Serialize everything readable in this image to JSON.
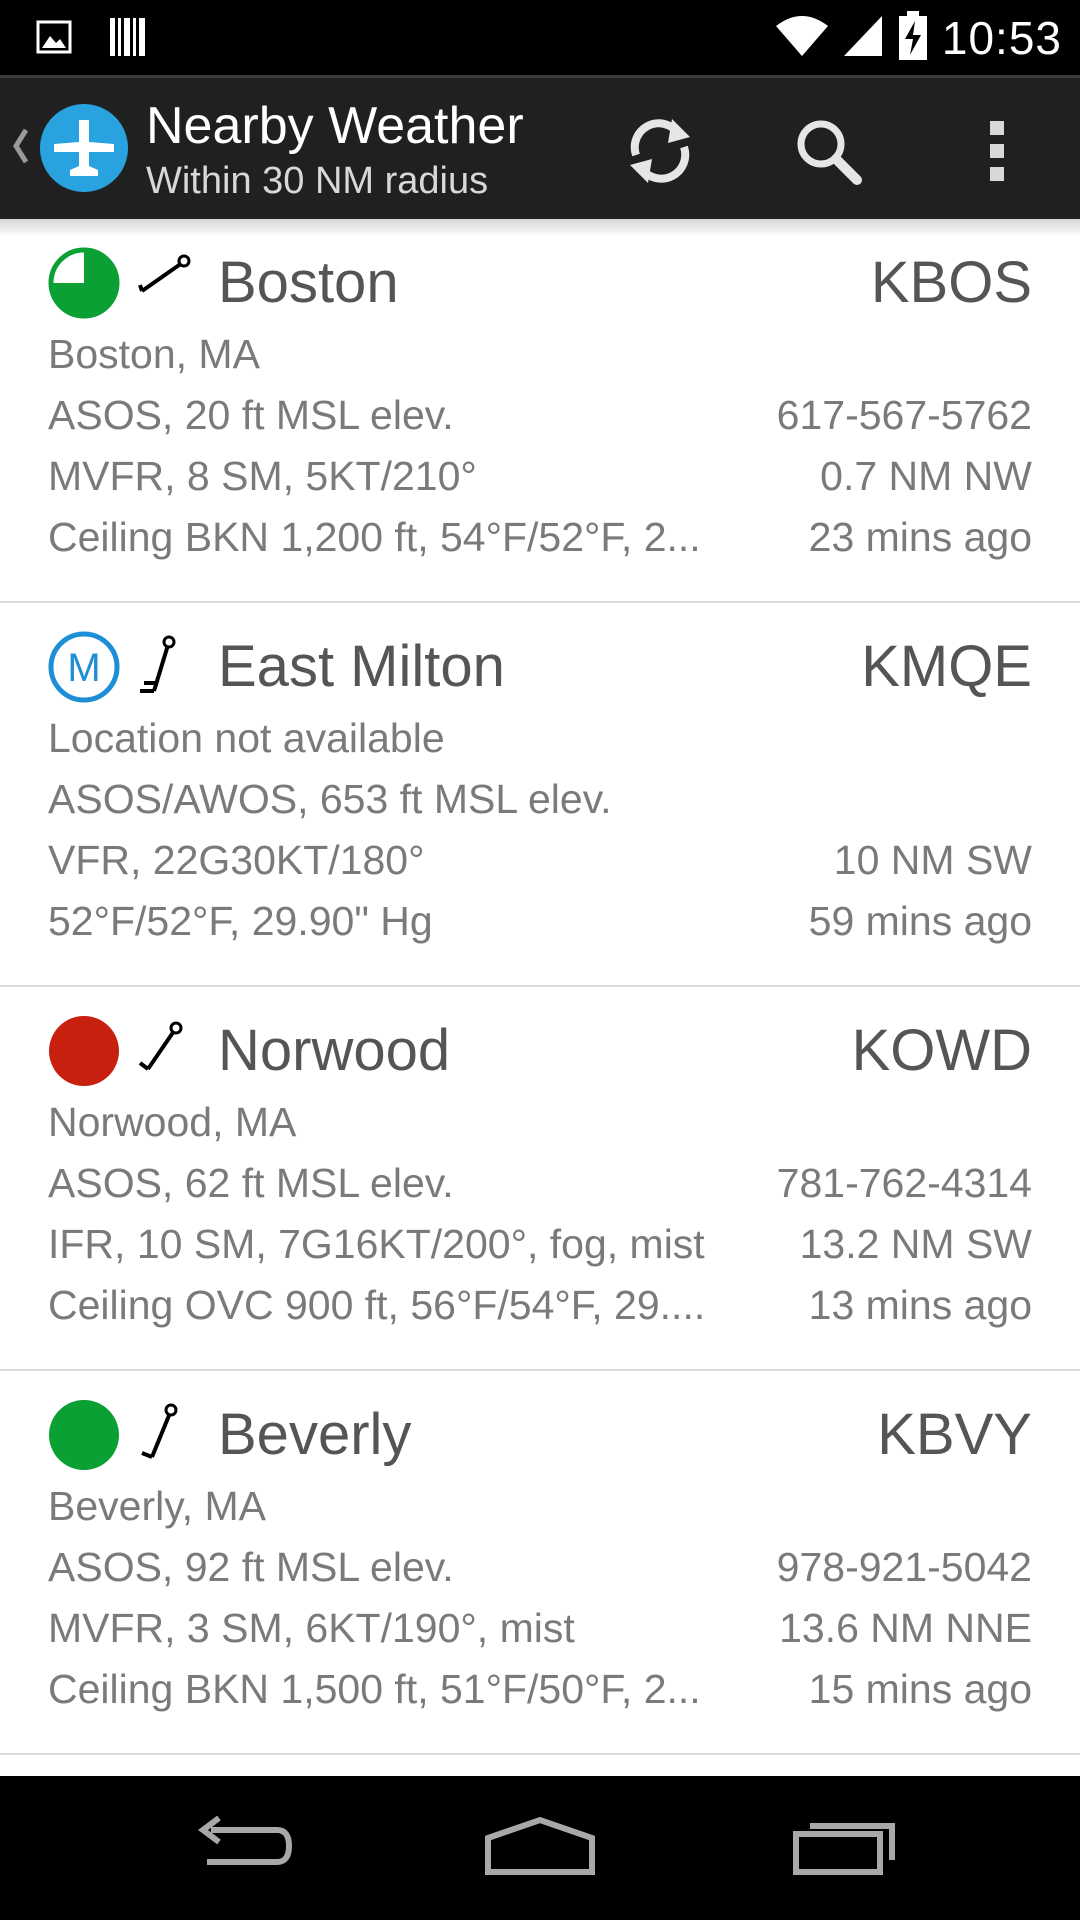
{
  "status_bar": {
    "time": "10:53",
    "left_icons": [
      "gallery-icon",
      "barcode-icon"
    ],
    "right_icons": [
      "wifi-icon",
      "signal-icon",
      "battery-charging-icon"
    ]
  },
  "action_bar": {
    "title": "Nearby Weather",
    "subtitle": "Within 30 NM radius",
    "icons": [
      "up-caret-icon",
      "airplane-logo-icon",
      "refresh-icon",
      "search-icon",
      "overflow-menu-icon"
    ]
  },
  "stations": [
    {
      "name": "Boston",
      "code": "KBOS",
      "location": "Boston, MA",
      "info": "ASOS, 20 ft MSL elev.",
      "phone": "617-567-5762",
      "conditions": "MVFR, 8 SM, 5KT/210°",
      "distance": "0.7 NM NW",
      "details": "Ceiling BKN 1,200 ft, 54°F/52°F, 2...",
      "age": "23 mins ago",
      "flight_category_color": "#0aa033"
    },
    {
      "name": "East Milton",
      "code": "KMQE",
      "location": "Location not available",
      "info": "ASOS/AWOS, 653 ft MSL elev.",
      "conditions": "VFR, 22G30KT/180°",
      "distance": "10 NM SW",
      "details": "52°F/52°F, 29.90\" Hg",
      "age": "59 mins ago",
      "indicator_letter": "M",
      "flight_category_color": "#1e8fd6"
    },
    {
      "name": "Norwood",
      "code": "KOWD",
      "location": "Norwood, MA",
      "info": "ASOS, 62 ft MSL elev.",
      "phone": "781-762-4314",
      "conditions": "IFR, 10 SM, 7G16KT/200°, fog, mist",
      "distance": "13.2 NM SW",
      "details": "Ceiling OVC 900 ft, 56°F/54°F, 29....",
      "age": "13 mins ago",
      "flight_category_color": "#c8200f"
    },
    {
      "name": "Beverly",
      "code": "KBVY",
      "location": "Beverly, MA",
      "info": "ASOS, 92 ft MSL elev.",
      "phone": "978-921-5042",
      "conditions": "MVFR, 3 SM, 6KT/190°, mist",
      "distance": "13.6 NM NNE",
      "details": "Ceiling BKN 1,500 ft, 51°F/50°F, 2...",
      "age": "15 mins ago",
      "flight_category_color": "#0aa033"
    }
  ],
  "nav_bar": {
    "icons": [
      "back-icon",
      "home-icon",
      "recent-apps-icon"
    ]
  }
}
